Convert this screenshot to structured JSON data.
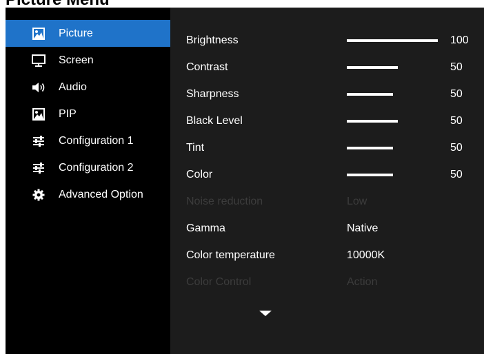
{
  "page_title": "Picture Menu",
  "sidebar": {
    "items": [
      {
        "label": "Picture",
        "icon": "picture-icon",
        "selected": true
      },
      {
        "label": "Screen",
        "icon": "monitor-icon"
      },
      {
        "label": "Audio",
        "icon": "speaker-icon"
      },
      {
        "label": "PIP",
        "icon": "picture-icon"
      },
      {
        "label": "Configuration 1",
        "icon": "sliders-icon"
      },
      {
        "label": "Configuration 2",
        "icon": "sliders-icon"
      },
      {
        "label": "Advanced Option",
        "icon": "gear-icon"
      }
    ]
  },
  "settings": [
    {
      "label": "Brightness",
      "type": "slider",
      "value": "100",
      "level": 1.0
    },
    {
      "label": "Contrast",
      "type": "slider",
      "value": "50",
      "level": 0.56
    },
    {
      "label": "Sharpness",
      "type": "slider",
      "value": "50",
      "level": 0.51
    },
    {
      "label": "Black Level",
      "type": "slider",
      "value": "50",
      "level": 0.56
    },
    {
      "label": "Tint",
      "type": "slider",
      "value": "50",
      "level": 0.51
    },
    {
      "label": "Color",
      "type": "slider",
      "value": "50",
      "level": 0.51
    },
    {
      "label": "Noise reduction",
      "type": "option",
      "value": "Low",
      "disabled": true
    },
    {
      "label": "Gamma",
      "type": "option",
      "value": "Native"
    },
    {
      "label": "Color temperature",
      "type": "option",
      "value": "10000K"
    },
    {
      "label": "Color Control",
      "type": "option",
      "value": "Action",
      "disabled": true
    }
  ],
  "scroll_indicator_icon": "triangle-down-icon",
  "colors": {
    "selection": "#1f73c9",
    "panel": "#000000",
    "content": "#1c1c1c",
    "disabled_text": "#3c3c3c"
  }
}
